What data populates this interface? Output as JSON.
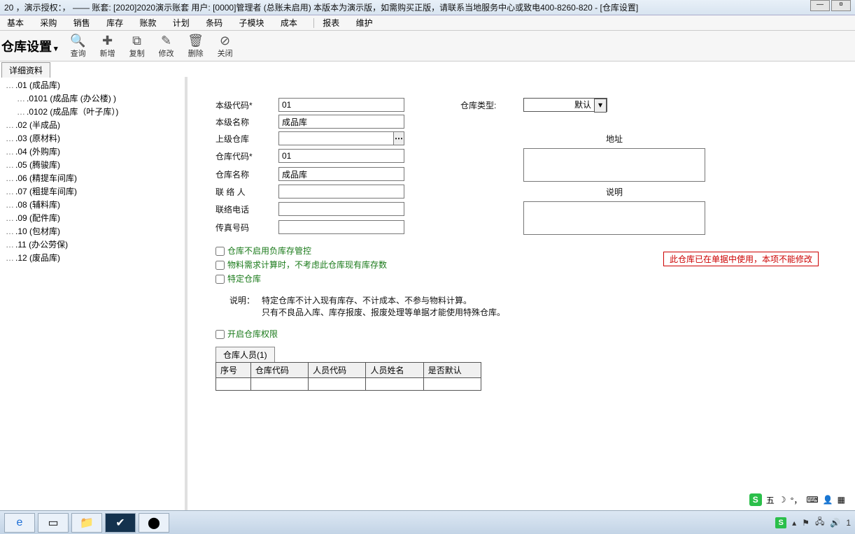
{
  "title_left": "20 ，演示授权：， —— 账套: [2020]2020演示账套  用户: [0000]管理者   (总账未启用)   本版本为演示版，如需购买正版，请联系当地服务中心或致电400-8260-820   -  [仓库设置]",
  "menu": [
    "基本",
    "采购",
    "销售",
    "库存",
    "账款",
    "计划",
    "条码",
    "子模块",
    "成本",
    "报表",
    "维护"
  ],
  "module_title": "仓库设置",
  "toolbar": [
    {
      "icon": "🔍",
      "label": "查询"
    },
    {
      "icon": "✚",
      "label": "新增"
    },
    {
      "icon": "⧉",
      "label": "复制"
    },
    {
      "icon": "✎",
      "label": "修改"
    },
    {
      "icon": "🗑",
      "label": "删除"
    },
    {
      "icon": "⊘",
      "label": "关闭"
    }
  ],
  "tab_main": "详细资料",
  "tree": [
    {
      "t": ".01 (成品库)",
      "c": 0
    },
    {
      "t": ".0101 (成品库 (办公楼) )",
      "c": 1
    },
    {
      "t": ".0102 (成品库（叶子库）)",
      "c": 1
    },
    {
      "t": ".02 (半成品)",
      "c": 0
    },
    {
      "t": ".03 (原材料)",
      "c": 0
    },
    {
      "t": ".04 (外购库)",
      "c": 0
    },
    {
      "t": ".05 (腾骏库)",
      "c": 0
    },
    {
      "t": ".06 (精提车间库)",
      "c": 0
    },
    {
      "t": ".07 (粗提车间库)",
      "c": 0
    },
    {
      "t": ".08 (辅料库)",
      "c": 0
    },
    {
      "t": ".09 (配件库)",
      "c": 0
    },
    {
      "t": ".10 (包材库)",
      "c": 0
    },
    {
      "t": ".11 (办公劳保)",
      "c": 0
    },
    {
      "t": ".12 (废品库)",
      "c": 0
    }
  ],
  "form": {
    "level_code_lbl": "本级代码*",
    "level_code": "01",
    "wh_type_lbl": "仓库类型:",
    "wh_type": "默认",
    "level_name_lbl": "本级名称",
    "level_name": "成品库",
    "parent_lbl": "上级仓库",
    "parent": "",
    "addr_lbl": "地址",
    "wh_code_lbl": "仓库代码*",
    "wh_code": "01",
    "wh_name_lbl": "仓库名称",
    "wh_name": "成品库",
    "contact_lbl": "联 络 人",
    "contact": "",
    "desc_lbl": "说明",
    "phone_lbl": "联络电话",
    "phone": "",
    "fax_lbl": "传真号码",
    "fax": ""
  },
  "checks": {
    "c1": "仓库不启用负库存管控",
    "c2": "物料需求计算时，不考虑此仓库现有库存数",
    "c3": "特定仓库",
    "c4": "开启仓库权限"
  },
  "warn": "此仓库已在单据中使用，本项不能修改",
  "explain_hd": "说明：",
  "explain_l1": "特定仓库不计入现有库存、不计成本、不参与物料计算。",
  "explain_l2": "只有不良品入库、库存报废、报废处理等单据才能使用特殊仓库。",
  "subtab": "仓库人员(1)",
  "grid_headers": [
    "序号",
    "仓库代码",
    "人员代码",
    "人员姓名",
    "是否默认"
  ],
  "ime_text": "五",
  "tray_time": "1"
}
